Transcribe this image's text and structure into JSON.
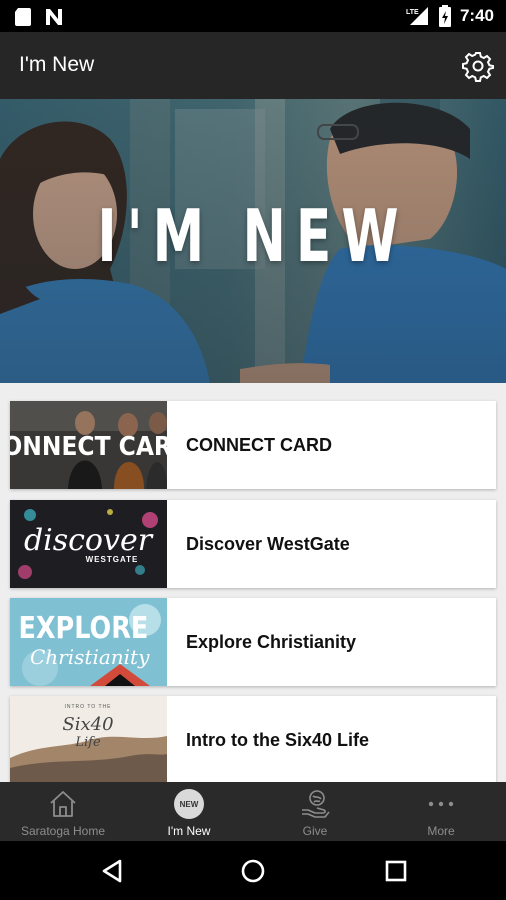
{
  "status_bar": {
    "time": "7:40",
    "lte_label": "LTE",
    "icons": [
      "sd-card-icon",
      "n-icon",
      "lte-signal-icon",
      "battery-icon"
    ]
  },
  "app_bar": {
    "title": "I'm New",
    "settings_icon": "gear-icon"
  },
  "hero": {
    "text": "I'M NEW"
  },
  "list": {
    "items": [
      {
        "label": "CONNECT CARD",
        "thumb_text": "CONNECT CARD"
      },
      {
        "label": "Discover WestGate",
        "thumb_text": "discover",
        "thumb_subtext": "WESTGATE"
      },
      {
        "label": "Explore Christianity",
        "thumb_text": "EXPLORE",
        "thumb_subtext": "Christianity"
      },
      {
        "label": "Intro to the Six40 Life",
        "thumb_top": "INTRO TO THE",
        "thumb_text": "Six40",
        "thumb_subtext": "Life"
      }
    ]
  },
  "bottom_nav": {
    "items": [
      {
        "label": "Saratoga Home",
        "icon": "home-icon",
        "active": false
      },
      {
        "label": "I'm New",
        "icon": "new-badge-icon",
        "badge": "NEW",
        "active": true
      },
      {
        "label": "Give",
        "icon": "give-hand-icon",
        "active": false
      },
      {
        "label": "More",
        "icon": "more-dots-icon",
        "active": false
      }
    ]
  },
  "system_nav": {
    "icons": [
      "back-icon",
      "home-circle-icon",
      "recents-icon"
    ]
  },
  "colors": {
    "app_bar": "#262626",
    "content_bg": "#eeeeee",
    "nav_bg": "#2a2a2a",
    "nav_inactive": "#8d8d8d",
    "nav_active": "#ffffff"
  }
}
